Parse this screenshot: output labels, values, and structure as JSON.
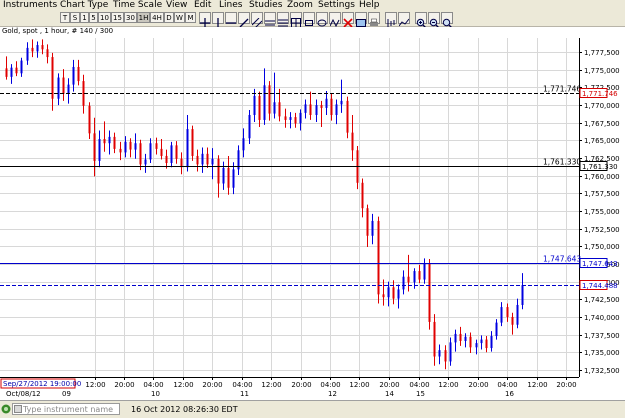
{
  "menu": [
    "Instruments",
    "Chart Type",
    "Time Scale",
    "View",
    "Edit",
    "Lines",
    "Studies",
    "Zoom",
    "Settings",
    "Help"
  ],
  "timeframes": [
    "T",
    "S",
    "1",
    "5",
    "10",
    "15",
    "30",
    "1H",
    "4H",
    "D",
    "W",
    "M"
  ],
  "chart_title": "Gold, spot , 1 hour, # 140 / 300",
  "chart_data": {
    "type": "candlestick",
    "ylim": [
      1731.5,
      1779.5
    ],
    "y_ticks": [
      "1,732,500",
      "1,735,000",
      "1,737,500",
      "1,740,000",
      "1,742,500",
      "1,745,000",
      "1,747,500",
      "1,750,000",
      "1,752,500",
      "1,755,000",
      "1,757,500",
      "1,760,000",
      "1,762,500",
      "1,765,000",
      "1,767,500",
      "1,770,000",
      "1,772,500",
      "1,775,000",
      "1,777,500"
    ],
    "x_ticks": [
      {
        "label": "12:00",
        "x": 95
      },
      {
        "label": "20:00",
        "x": 124
      },
      {
        "label": "04:00",
        "x": 153
      },
      {
        "label": "12:00",
        "x": 183
      },
      {
        "label": "20:00",
        "x": 212
      },
      {
        "label": "04:00",
        "x": 242
      },
      {
        "label": "12:00",
        "x": 271
      },
      {
        "label": "20:00",
        "x": 301
      },
      {
        "label": "04:00",
        "x": 330
      },
      {
        "label": "12:00",
        "x": 359
      },
      {
        "label": "20:00",
        "x": 389
      },
      {
        "label": "04:00",
        "x": 419
      },
      {
        "label": "12:00",
        "x": 448
      },
      {
        "label": "20:00",
        "x": 478
      },
      {
        "label": "04:00",
        "x": 507
      },
      {
        "label": "12:00",
        "x": 537
      },
      {
        "label": "20:00",
        "x": 566
      }
    ],
    "date_labels": [
      {
        "label": "Oct/08/12",
        "x": 6
      },
      {
        "label": "09",
        "x": 62
      },
      {
        "label": "10",
        "x": 151
      },
      {
        "label": "11",
        "x": 240
      },
      {
        "label": "12",
        "x": 328
      },
      {
        "label": "14",
        "x": 385
      },
      {
        "label": "15",
        "x": 416
      },
      {
        "label": "16",
        "x": 505
      }
    ],
    "cursor_date": "Sep/27/2012 19:00:00",
    "h_lines": [
      {
        "value": 1771.746,
        "label": "1,771.746",
        "style": "dashed",
        "color": "#000000",
        "tag_color": "#d40000"
      },
      {
        "value": 1761.33,
        "label": "1,761.330",
        "style": "solid",
        "color": "#000000",
        "tag_color": "#000000"
      },
      {
        "value": 1747.643,
        "label": "1,747.643",
        "style": "solid",
        "color": "#0000cc",
        "tag_color": "#0000cc"
      },
      {
        "value": 1744.488,
        "label": "1,744.488",
        "style": "dashed",
        "color": "#0000cc",
        "tag_color": "#d40000",
        "price_tag": true
      }
    ],
    "colors": {
      "up": "#0000e0",
      "down": "#e00000",
      "grid": "#d8d8d8"
    },
    "candles": [
      {
        "o": 1775.2,
        "h": 1776.9,
        "l": 1773.6,
        "c": 1774.0
      },
      {
        "o": 1774.0,
        "h": 1775.8,
        "l": 1773.0,
        "c": 1775.3
      },
      {
        "o": 1775.3,
        "h": 1776.2,
        "l": 1774.1,
        "c": 1774.5
      },
      {
        "o": 1774.5,
        "h": 1776.7,
        "l": 1774.0,
        "c": 1776.3
      },
      {
        "o": 1776.3,
        "h": 1778.9,
        "l": 1775.7,
        "c": 1778.1
      },
      {
        "o": 1778.1,
        "h": 1779.3,
        "l": 1776.8,
        "c": 1777.6
      },
      {
        "o": 1777.6,
        "h": 1779.0,
        "l": 1776.7,
        "c": 1778.5
      },
      {
        "o": 1778.5,
        "h": 1779.3,
        "l": 1777.2,
        "c": 1777.9
      },
      {
        "o": 1777.9,
        "h": 1778.6,
        "l": 1775.9,
        "c": 1776.8
      },
      {
        "o": 1776.8,
        "h": 1777.4,
        "l": 1769.2,
        "c": 1770.9
      },
      {
        "o": 1770.9,
        "h": 1774.5,
        "l": 1770.0,
        "c": 1773.9
      },
      {
        "o": 1773.9,
        "h": 1775.1,
        "l": 1770.6,
        "c": 1771.6
      },
      {
        "o": 1771.6,
        "h": 1773.8,
        "l": 1770.2,
        "c": 1772.9
      },
      {
        "o": 1772.9,
        "h": 1776.4,
        "l": 1771.9,
        "c": 1775.4
      },
      {
        "o": 1775.4,
        "h": 1776.4,
        "l": 1772.8,
        "c": 1773.4
      },
      {
        "o": 1773.4,
        "h": 1774.3,
        "l": 1768.8,
        "c": 1769.9
      },
      {
        "o": 1769.9,
        "h": 1770.4,
        "l": 1765.2,
        "c": 1766.0
      },
      {
        "o": 1766.0,
        "h": 1768.2,
        "l": 1759.9,
        "c": 1762.1
      },
      {
        "o": 1762.1,
        "h": 1766.4,
        "l": 1761.2,
        "c": 1765.2
      },
      {
        "o": 1765.2,
        "h": 1767.7,
        "l": 1763.4,
        "c": 1764.6
      },
      {
        "o": 1764.6,
        "h": 1766.4,
        "l": 1763.0,
        "c": 1765.5
      },
      {
        "o": 1765.5,
        "h": 1766.1,
        "l": 1763.2,
        "c": 1763.8
      },
      {
        "o": 1763.8,
        "h": 1764.8,
        "l": 1762.2,
        "c": 1763.3
      },
      {
        "o": 1763.3,
        "h": 1765.6,
        "l": 1762.6,
        "c": 1764.8
      },
      {
        "o": 1764.8,
        "h": 1765.3,
        "l": 1762.6,
        "c": 1763.7
      },
      {
        "o": 1763.7,
        "h": 1766.0,
        "l": 1762.4,
        "c": 1764.6
      },
      {
        "o": 1764.6,
        "h": 1765.1,
        "l": 1760.8,
        "c": 1761.6
      },
      {
        "o": 1761.6,
        "h": 1763.1,
        "l": 1760.4,
        "c": 1762.3
      },
      {
        "o": 1762.3,
        "h": 1765.3,
        "l": 1761.8,
        "c": 1764.6
      },
      {
        "o": 1764.6,
        "h": 1765.4,
        "l": 1763.0,
        "c": 1763.8
      },
      {
        "o": 1763.8,
        "h": 1765.2,
        "l": 1762.3,
        "c": 1762.8
      },
      {
        "o": 1762.8,
        "h": 1763.7,
        "l": 1761.0,
        "c": 1761.8
      },
      {
        "o": 1761.8,
        "h": 1764.8,
        "l": 1761.2,
        "c": 1764.3
      },
      {
        "o": 1764.3,
        "h": 1764.9,
        "l": 1761.7,
        "c": 1762.4
      },
      {
        "o": 1762.4,
        "h": 1763.3,
        "l": 1760.2,
        "c": 1761.2
      },
      {
        "o": 1761.2,
        "h": 1768.6,
        "l": 1760.6,
        "c": 1766.6
      },
      {
        "o": 1766.6,
        "h": 1767.1,
        "l": 1762.1,
        "c": 1762.8
      },
      {
        "o": 1762.8,
        "h": 1763.7,
        "l": 1760.6,
        "c": 1761.6
      },
      {
        "o": 1761.6,
        "h": 1764.0,
        "l": 1760.4,
        "c": 1763.1
      },
      {
        "o": 1763.1,
        "h": 1764.0,
        "l": 1761.1,
        "c": 1761.6
      },
      {
        "o": 1761.6,
        "h": 1763.9,
        "l": 1759.5,
        "c": 1762.4
      },
      {
        "o": 1762.4,
        "h": 1762.9,
        "l": 1756.9,
        "c": 1758.9
      },
      {
        "o": 1758.9,
        "h": 1762.0,
        "l": 1758.0,
        "c": 1761.1
      },
      {
        "o": 1761.1,
        "h": 1762.8,
        "l": 1757.3,
        "c": 1758.3
      },
      {
        "o": 1758.3,
        "h": 1761.9,
        "l": 1757.4,
        "c": 1760.9
      },
      {
        "o": 1760.9,
        "h": 1764.3,
        "l": 1760.1,
        "c": 1763.6
      },
      {
        "o": 1763.6,
        "h": 1766.7,
        "l": 1762.6,
        "c": 1765.3
      },
      {
        "o": 1765.3,
        "h": 1769.3,
        "l": 1764.5,
        "c": 1768.6
      },
      {
        "o": 1768.6,
        "h": 1772.3,
        "l": 1767.6,
        "c": 1771.3
      },
      {
        "o": 1771.3,
        "h": 1771.9,
        "l": 1766.9,
        "c": 1767.9
      },
      {
        "o": 1767.9,
        "h": 1775.2,
        "l": 1767.2,
        "c": 1772.8
      },
      {
        "o": 1772.8,
        "h": 1773.4,
        "l": 1767.8,
        "c": 1768.8
      },
      {
        "o": 1768.8,
        "h": 1774.6,
        "l": 1768.1,
        "c": 1770.4
      },
      {
        "o": 1770.4,
        "h": 1772.3,
        "l": 1767.7,
        "c": 1768.4
      },
      {
        "o": 1768.4,
        "h": 1769.5,
        "l": 1766.8,
        "c": 1767.9
      },
      {
        "o": 1767.9,
        "h": 1769.0,
        "l": 1766.7,
        "c": 1768.3
      },
      {
        "o": 1768.3,
        "h": 1768.9,
        "l": 1766.8,
        "c": 1767.4
      },
      {
        "o": 1767.4,
        "h": 1769.4,
        "l": 1766.4,
        "c": 1768.9
      },
      {
        "o": 1768.9,
        "h": 1770.8,
        "l": 1768.1,
        "c": 1770.1
      },
      {
        "o": 1770.1,
        "h": 1771.9,
        "l": 1767.9,
        "c": 1768.6
      },
      {
        "o": 1768.6,
        "h": 1770.8,
        "l": 1767.6,
        "c": 1770.0
      },
      {
        "o": 1770.0,
        "h": 1770.6,
        "l": 1766.9,
        "c": 1769.6
      },
      {
        "o": 1769.6,
        "h": 1772.0,
        "l": 1768.6,
        "c": 1770.9
      },
      {
        "o": 1770.9,
        "h": 1771.6,
        "l": 1767.8,
        "c": 1768.6
      },
      {
        "o": 1768.6,
        "h": 1770.8,
        "l": 1767.3,
        "c": 1770.1
      },
      {
        "o": 1770.1,
        "h": 1773.6,
        "l": 1768.9,
        "c": 1770.6
      },
      {
        "o": 1770.6,
        "h": 1771.2,
        "l": 1765.3,
        "c": 1766.1
      },
      {
        "o": 1766.1,
        "h": 1768.6,
        "l": 1762.1,
        "c": 1763.6
      },
      {
        "o": 1763.6,
        "h": 1764.2,
        "l": 1758.1,
        "c": 1759.0
      },
      {
        "o": 1759.0,
        "h": 1759.6,
        "l": 1754.1,
        "c": 1755.4
      },
      {
        "o": 1755.4,
        "h": 1755.9,
        "l": 1749.9,
        "c": 1751.5
      },
      {
        "o": 1751.5,
        "h": 1754.6,
        "l": 1750.3,
        "c": 1753.6
      },
      {
        "o": 1753.6,
        "h": 1754.2,
        "l": 1741.9,
        "c": 1743.2
      },
      {
        "o": 1743.2,
        "h": 1745.3,
        "l": 1741.6,
        "c": 1742.8
      },
      {
        "o": 1742.8,
        "h": 1745.0,
        "l": 1741.5,
        "c": 1744.2
      },
      {
        "o": 1744.2,
        "h": 1745.2,
        "l": 1741.8,
        "c": 1742.6
      },
      {
        "o": 1742.6,
        "h": 1744.6,
        "l": 1741.2,
        "c": 1743.9
      },
      {
        "o": 1743.9,
        "h": 1746.6,
        "l": 1743.2,
        "c": 1745.7
      },
      {
        "o": 1745.7,
        "h": 1748.8,
        "l": 1743.6,
        "c": 1744.9
      },
      {
        "o": 1744.9,
        "h": 1746.9,
        "l": 1744.0,
        "c": 1746.5
      },
      {
        "o": 1746.5,
        "h": 1747.4,
        "l": 1744.8,
        "c": 1745.3
      },
      {
        "o": 1745.3,
        "h": 1748.3,
        "l": 1744.7,
        "c": 1747.6
      },
      {
        "o": 1747.6,
        "h": 1748.2,
        "l": 1738.2,
        "c": 1739.3
      },
      {
        "o": 1739.3,
        "h": 1740.4,
        "l": 1733.1,
        "c": 1734.4
      },
      {
        "o": 1734.4,
        "h": 1736.1,
        "l": 1733.3,
        "c": 1735.3
      },
      {
        "o": 1735.3,
        "h": 1736.0,
        "l": 1732.6,
        "c": 1733.7
      },
      {
        "o": 1733.7,
        "h": 1737.1,
        "l": 1733.1,
        "c": 1736.4
      },
      {
        "o": 1736.4,
        "h": 1738.2,
        "l": 1735.1,
        "c": 1737.6
      },
      {
        "o": 1737.6,
        "h": 1738.6,
        "l": 1735.9,
        "c": 1736.6
      },
      {
        "o": 1736.6,
        "h": 1737.7,
        "l": 1735.7,
        "c": 1737.2
      },
      {
        "o": 1737.2,
        "h": 1737.8,
        "l": 1734.9,
        "c": 1735.7
      },
      {
        "o": 1735.7,
        "h": 1736.8,
        "l": 1734.7,
        "c": 1736.3
      },
      {
        "o": 1736.3,
        "h": 1737.4,
        "l": 1735.4,
        "c": 1736.8
      },
      {
        "o": 1736.8,
        "h": 1737.3,
        "l": 1735.0,
        "c": 1735.6
      },
      {
        "o": 1735.6,
        "h": 1738.0,
        "l": 1735.1,
        "c": 1737.3
      },
      {
        "o": 1737.3,
        "h": 1739.7,
        "l": 1736.8,
        "c": 1739.2
      },
      {
        "o": 1739.2,
        "h": 1742.1,
        "l": 1738.7,
        "c": 1741.4
      },
      {
        "o": 1741.4,
        "h": 1741.9,
        "l": 1739.3,
        "c": 1740.0
      },
      {
        "o": 1740.0,
        "h": 1740.6,
        "l": 1737.5,
        "c": 1738.9
      },
      {
        "o": 1738.9,
        "h": 1742.6,
        "l": 1738.4,
        "c": 1741.7
      },
      {
        "o": 1741.7,
        "h": 1746.2,
        "l": 1741.1,
        "c": 1744.5
      }
    ]
  },
  "status": {
    "instrument_placeholder": "Type instrument name",
    "time": "16 Oct 2012 08:26:30 EDT"
  }
}
